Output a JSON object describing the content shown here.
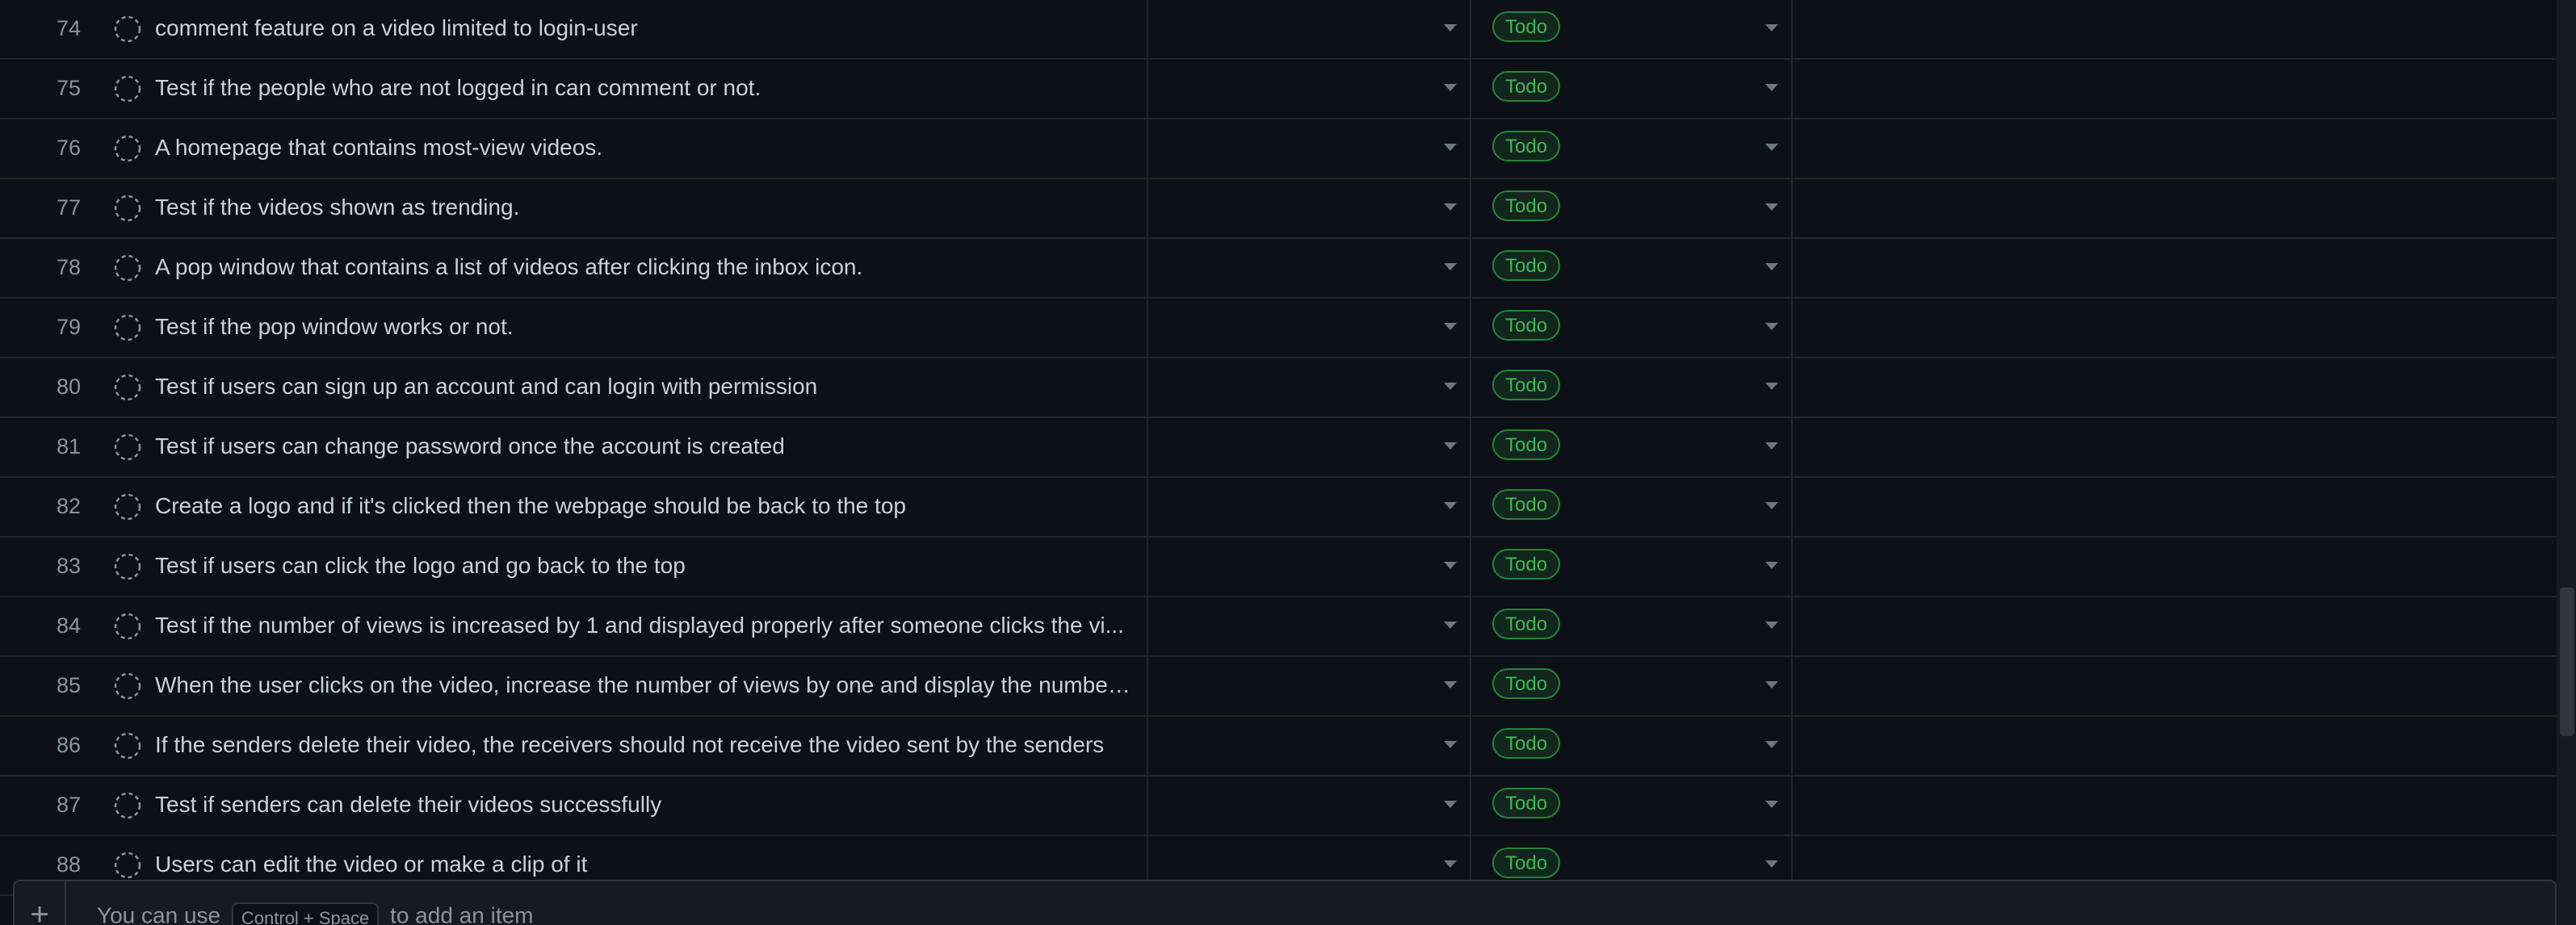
{
  "rows": [
    {
      "num": "74",
      "title": "comment feature on a video limited to login-user",
      "status": "Todo"
    },
    {
      "num": "75",
      "title": "Test if the people who are not logged in can comment or not.",
      "status": "Todo"
    },
    {
      "num": "76",
      "title": "A homepage that contains most-view videos.",
      "status": "Todo"
    },
    {
      "num": "77",
      "title": "Test if the videos shown as trending.",
      "status": "Todo"
    },
    {
      "num": "78",
      "title": "A pop window that contains a list of videos after clicking the inbox icon.",
      "status": "Todo"
    },
    {
      "num": "79",
      "title": "Test if the pop window works or not.",
      "status": "Todo"
    },
    {
      "num": "80",
      "title": "Test if users can sign up an account and can login with permission",
      "status": "Todo"
    },
    {
      "num": "81",
      "title": "Test if users can change password once the account is created",
      "status": "Todo"
    },
    {
      "num": "82",
      "title": "Create a logo and if it's clicked then the webpage should be back to the top",
      "status": "Todo"
    },
    {
      "num": "83",
      "title": "Test if users can click the logo and go back to the top",
      "status": "Todo"
    },
    {
      "num": "84",
      "title": "Test if the number of views is increased by 1 and displayed properly after someone clicks the vi...",
      "status": "Todo"
    },
    {
      "num": "85",
      "title": "When the user clicks on the video, increase the number of views by one and display the number...",
      "status": "Todo"
    },
    {
      "num": "86",
      "title": "If the senders delete their video, the receivers should not receive the video sent by the senders",
      "status": "Todo"
    },
    {
      "num": "87",
      "title": "Test if senders can delete their videos successfully",
      "status": "Todo"
    },
    {
      "num": "88",
      "title": "Users can edit the video or make a clip of it",
      "status": "Todo"
    }
  ],
  "add_item": {
    "plus_icon": "+",
    "hint_before": "You can use",
    "shortcut": "Control + Space",
    "hint_after": "to add an item"
  },
  "colors": {
    "background": "#0d1117",
    "status_todo_text": "#3fb950",
    "status_todo_border": "#238636"
  }
}
